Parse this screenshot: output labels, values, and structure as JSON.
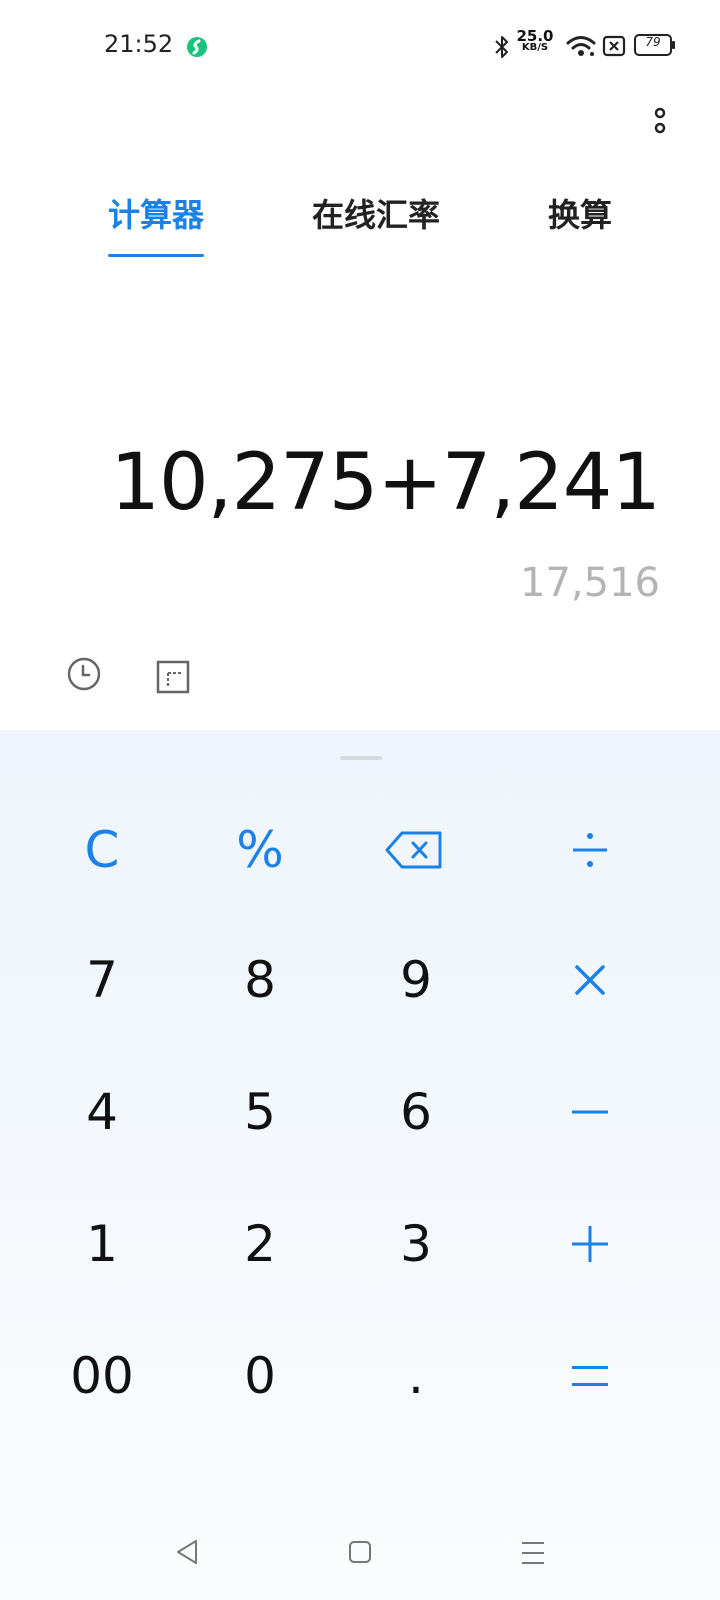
{
  "status_bar": {
    "time": "21:52",
    "net_speed_value": "25.0",
    "net_speed_unit": "KB/S",
    "battery_level": "79"
  },
  "tabs": [
    {
      "label": "计算器",
      "active": true
    },
    {
      "label": "在线汇率",
      "active": false
    },
    {
      "label": "换算",
      "active": false
    }
  ],
  "display": {
    "expression": "10,275+7,241",
    "result": "17,516"
  },
  "keys": {
    "clear": "C",
    "percent": "%",
    "seven": "7",
    "eight": "8",
    "nine": "9",
    "four": "4",
    "five": "5",
    "six": "6",
    "one": "1",
    "two": "2",
    "three": "3",
    "double_zero": "00",
    "zero": "0",
    "decimal": "."
  },
  "colors": {
    "accent": "#1a82e6",
    "result_text": "#b4b4b4",
    "keypad_bg": "#eef5fc"
  },
  "icons": {
    "more": "more-vertical-icon",
    "history": "clock-icon",
    "mode": "scientific-mode-icon",
    "backspace": "backspace-icon",
    "divide": "divide-icon",
    "multiply": "multiply-icon",
    "minus": "minus-icon",
    "plus": "plus-icon",
    "equals": "equals-icon"
  }
}
